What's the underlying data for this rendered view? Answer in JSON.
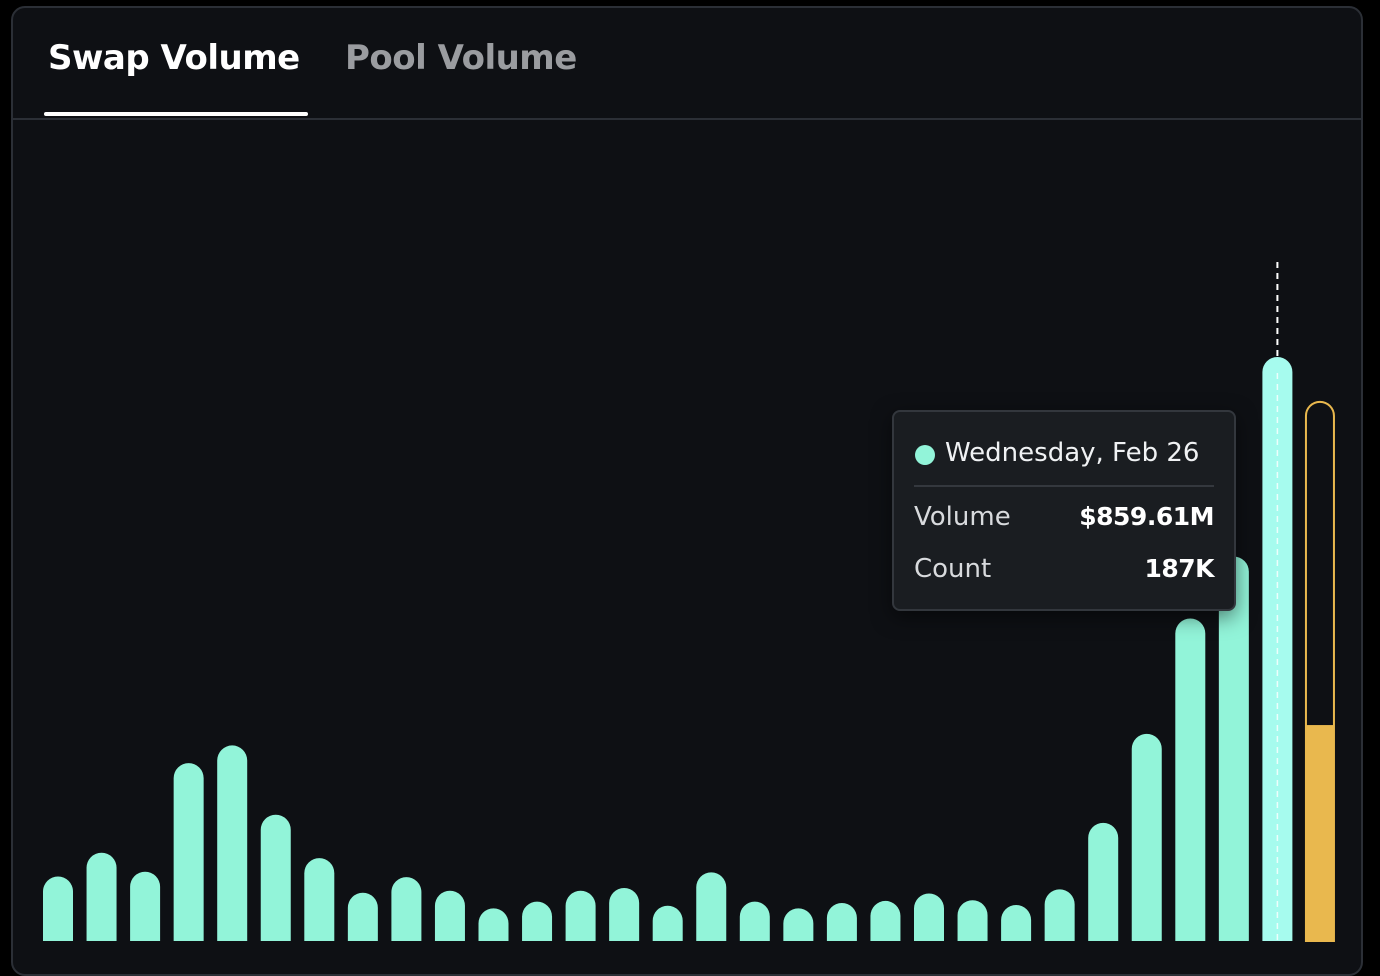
{
  "tabs": [
    {
      "label": "Swap Volume",
      "active": true
    },
    {
      "label": "Pool Volume",
      "active": false
    }
  ],
  "tooltip": {
    "date": "Wednesday, Feb 26",
    "rows": [
      {
        "label": "Volume",
        "value": "$859.61M"
      },
      {
        "label": "Count",
        "value": "187K"
      }
    ],
    "dot_color": "#92f4d9"
  },
  "colors": {
    "bar": "#92f4d9",
    "bar_highlight": "#a6fbee",
    "current_period": "#e9b84e",
    "background": "#0e1014"
  },
  "chart_data": {
    "type": "bar",
    "title": "",
    "xlabel": "",
    "ylabel": "",
    "highlighted_index": 28,
    "highlighted_label": "Wednesday, Feb 26",
    "ylim": [
      0,
      860
    ],
    "values": [
      95,
      130,
      102,
      262,
      288,
      186,
      122,
      71,
      94,
      74,
      48,
      58,
      74,
      78,
      52,
      101,
      58,
      48,
      56,
      59,
      70,
      60,
      53,
      76,
      174,
      305,
      475,
      566,
      860
    ],
    "current_period": {
      "value": 318,
      "outline_max": 794
    }
  }
}
